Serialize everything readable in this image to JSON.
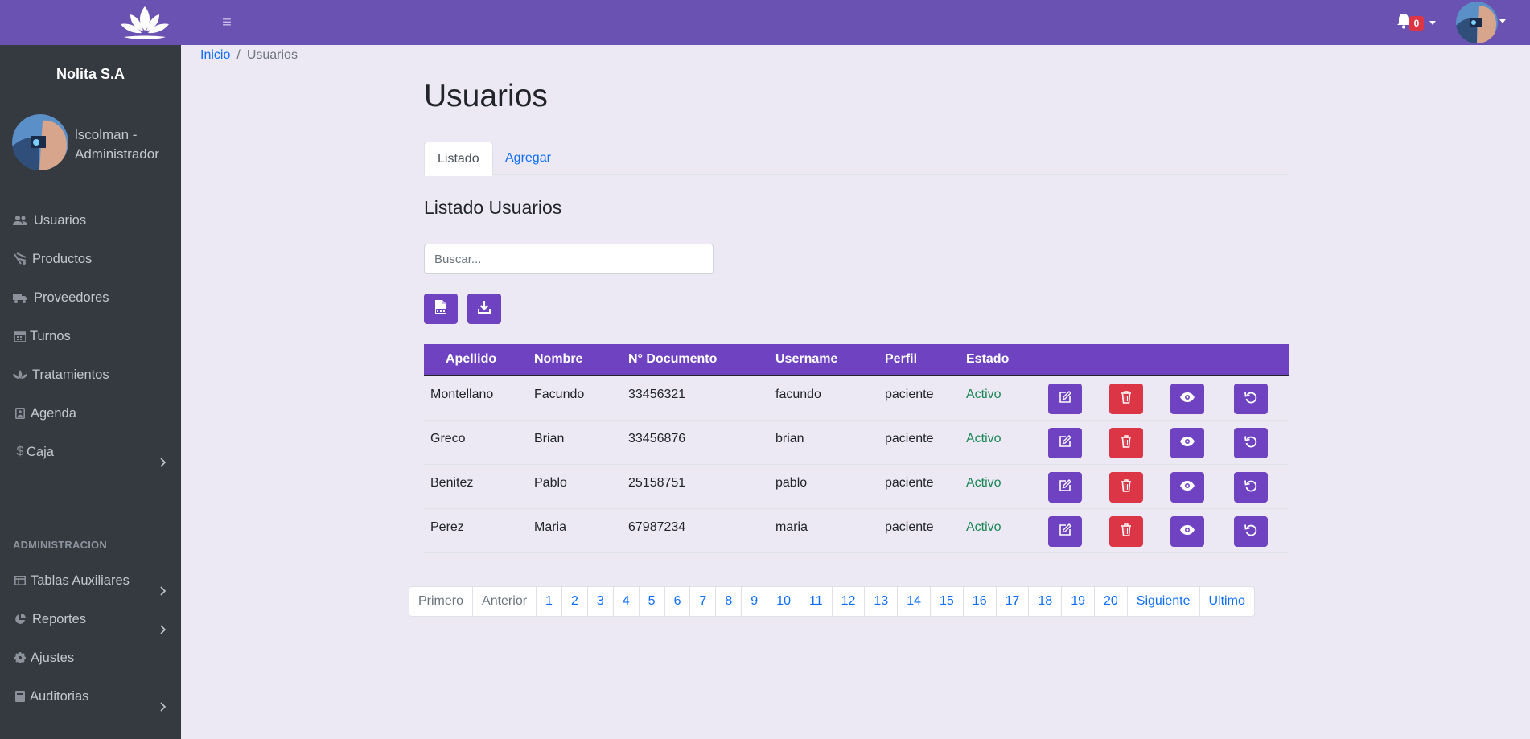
{
  "header": {
    "notifications_count": "0"
  },
  "sidebar": {
    "brand": "Nolita S.A",
    "user": "lscolman - Administrador",
    "items": [
      {
        "label": "Usuarios",
        "icon": "users-icon"
      },
      {
        "label": "Productos",
        "icon": "products-icon"
      },
      {
        "label": "Proveedores",
        "icon": "truck-icon"
      },
      {
        "label": "Turnos",
        "icon": "calendar-icon"
      },
      {
        "label": "Tratamientos",
        "icon": "lotus-icon"
      },
      {
        "label": "Agenda",
        "icon": "address-book-icon"
      },
      {
        "label": "Caja",
        "icon": "dollar-icon"
      }
    ],
    "section_header": "ADMINISTRACION",
    "admin_items": [
      {
        "label": "Tablas Auxiliares",
        "icon": "table-icon"
      },
      {
        "label": "Reportes",
        "icon": "chart-pie-icon"
      },
      {
        "label": "Ajustes",
        "icon": "gear-icon"
      },
      {
        "label": "Auditorias",
        "icon": "book-icon"
      }
    ]
  },
  "breadcrumb": {
    "home": "Inicio",
    "current": "Usuarios"
  },
  "page_title": "Usuarios",
  "tabs": {
    "active": "Listado",
    "other": "Agregar"
  },
  "section_title": "Listado Usuarios",
  "search": {
    "placeholder": "Buscar...",
    "value": ""
  },
  "table": {
    "headers": [
      "Apellido",
      "Nombre",
      "N° Documento",
      "Username",
      "Perfil",
      "Estado"
    ],
    "rows": [
      [
        "Montellano",
        "Facundo",
        "33456321",
        "facundo",
        "paciente",
        "Activo"
      ],
      [
        "Greco",
        "Brian",
        "33456876",
        "brian",
        "paciente",
        "Activo"
      ],
      [
        "Benitez",
        "Pablo",
        "25158751",
        "pablo",
        "paciente",
        "Activo"
      ],
      [
        "Perez",
        "Maria",
        "67987234",
        "maria",
        "paciente",
        "Activo"
      ]
    ]
  },
  "pagination": {
    "first": "Primero",
    "prev": "Anterior",
    "pages": [
      "1",
      "2",
      "3",
      "4",
      "5",
      "6",
      "7",
      "8",
      "9",
      "10",
      "11",
      "12",
      "13",
      "14",
      "15",
      "16",
      "17",
      "18",
      "19",
      "20"
    ],
    "next": "Siguiente",
    "last": "Ultimo"
  },
  "colors": {
    "topbar": "#6a52b3",
    "primary": "#6f42c1",
    "danger": "#dc3545",
    "success": "#198754",
    "sidebar": "#343a40"
  }
}
